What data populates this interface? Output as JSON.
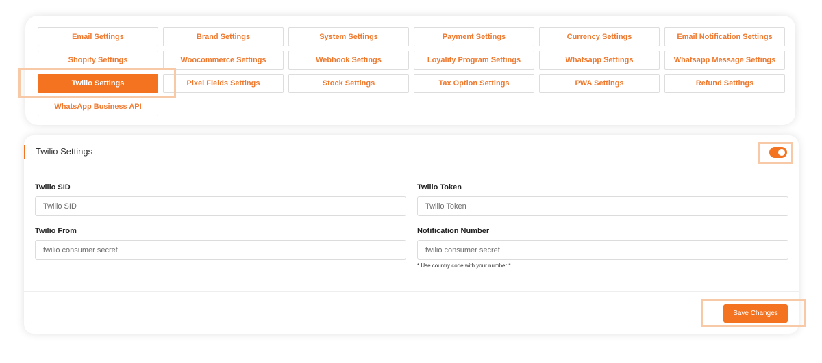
{
  "tabs": [
    {
      "label": "Email Settings"
    },
    {
      "label": "Brand Settings"
    },
    {
      "label": "System Settings"
    },
    {
      "label": "Payment Settings"
    },
    {
      "label": "Currency Settings"
    },
    {
      "label": "Email Notification Settings"
    },
    {
      "label": "Shopify Settings"
    },
    {
      "label": "Woocommerce Settings"
    },
    {
      "label": "Webhook Settings"
    },
    {
      "label": "Loyality Program Settings"
    },
    {
      "label": "Whatsapp Settings"
    },
    {
      "label": "Whatsapp Message Settings"
    },
    {
      "label": "Twilio Settings"
    },
    {
      "label": "Pixel Fields Settings"
    },
    {
      "label": "Stock Settings"
    },
    {
      "label": "Tax Option Settings"
    },
    {
      "label": "PWA Settings"
    },
    {
      "label": "Refund Settings"
    },
    {
      "label": "WhatsApp Business API"
    }
  ],
  "active_tab": "Twilio Settings",
  "panel": {
    "title": "Twilio Settings",
    "enabled": true,
    "fields": {
      "sid": {
        "label": "Twilio SID",
        "placeholder": "Twilio SID",
        "value": ""
      },
      "token": {
        "label": "Twilio Token",
        "placeholder": "Twilio Token",
        "value": ""
      },
      "from": {
        "label": "Twilio From",
        "placeholder": "twilio consumer secret",
        "value": ""
      },
      "notification": {
        "label": "Notification Number",
        "placeholder": "twilio consumer secret",
        "value": ""
      }
    },
    "hint": "* Use country code with your number *",
    "save_label": "Save Changes"
  },
  "colors": {
    "accent": "#f47320",
    "highlight": "#f7c9a6",
    "tab_text": "#ef7a2f"
  }
}
